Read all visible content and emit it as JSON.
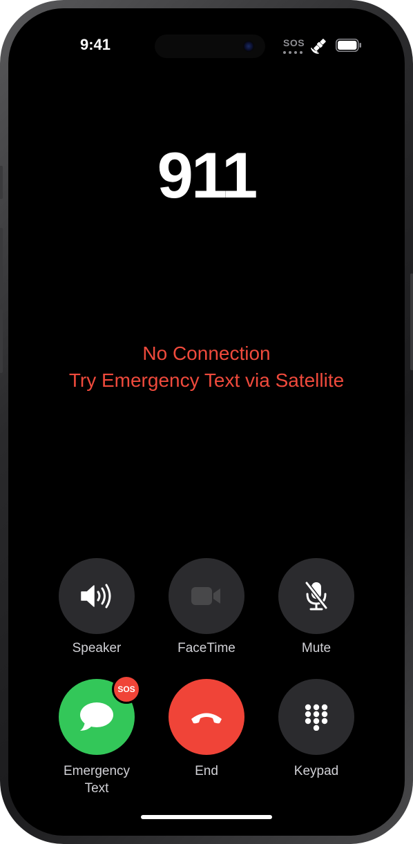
{
  "status_bar": {
    "time": "9:41",
    "sos_label": "SOS",
    "satellite_icon": "satellite-icon",
    "battery_icon": "battery-icon"
  },
  "call": {
    "number": "911",
    "status_line_1": "No Connection",
    "status_line_2": "Try Emergency Text via Satellite"
  },
  "controls": {
    "speaker": {
      "label": "Speaker",
      "icon": "speaker-icon",
      "enabled": true
    },
    "facetime": {
      "label": "FaceTime",
      "icon": "video-camera-icon",
      "enabled": false
    },
    "mute": {
      "label": "Mute",
      "icon": "microphone-slash-icon",
      "enabled": true
    },
    "emergency_text": {
      "label_line_1": "Emergency",
      "label_line_2": "Text",
      "icon": "message-bubble-icon",
      "badge": "SOS"
    },
    "end": {
      "label": "End",
      "icon": "phone-down-icon"
    },
    "keypad": {
      "label": "Keypad",
      "icon": "keypad-grid-icon"
    }
  },
  "colors": {
    "status_red": "#ef4a3c",
    "messages_green": "#33c759",
    "end_red": "#f04438",
    "button_gray": "#2b2b2e"
  }
}
